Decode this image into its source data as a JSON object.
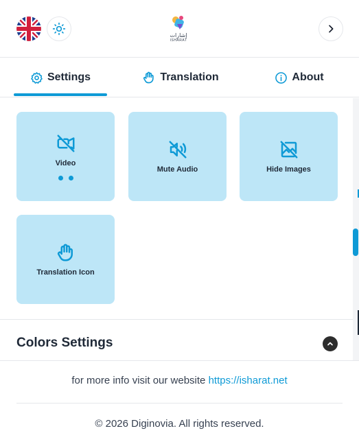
{
  "header": {
    "language_icon": "uk-flag-icon",
    "theme_icon": "sun-icon",
    "logo_text_ar": "إشارات",
    "logo_text_en": "ISHARAT",
    "next_icon": "chevron-right-icon"
  },
  "tabs": [
    {
      "label": "Settings",
      "icon": "gear-icon",
      "active": true
    },
    {
      "label": "Translation",
      "icon": "hand-icon",
      "active": false
    },
    {
      "label": "About",
      "icon": "info-icon",
      "active": false
    }
  ],
  "cards": [
    {
      "label": "Video",
      "icon": "video-off-icon"
    },
    {
      "label": "Mute Audio",
      "icon": "volume-off-icon"
    },
    {
      "label": "Hide Images",
      "icon": "image-off-icon"
    },
    {
      "label": "Translation Icon",
      "icon": "hand-icon"
    }
  ],
  "section": {
    "title": "Colors Settings",
    "toggle_icon": "chevron-up-icon"
  },
  "footer": {
    "info_text": "for more info visit our website",
    "website": "https://isharat.net",
    "copyright": "© 2026 Diginovia. All rights reserved."
  },
  "colors": {
    "accent": "#0e9ad6",
    "card_bg": "#bde6f7",
    "text": "#1f2937"
  }
}
